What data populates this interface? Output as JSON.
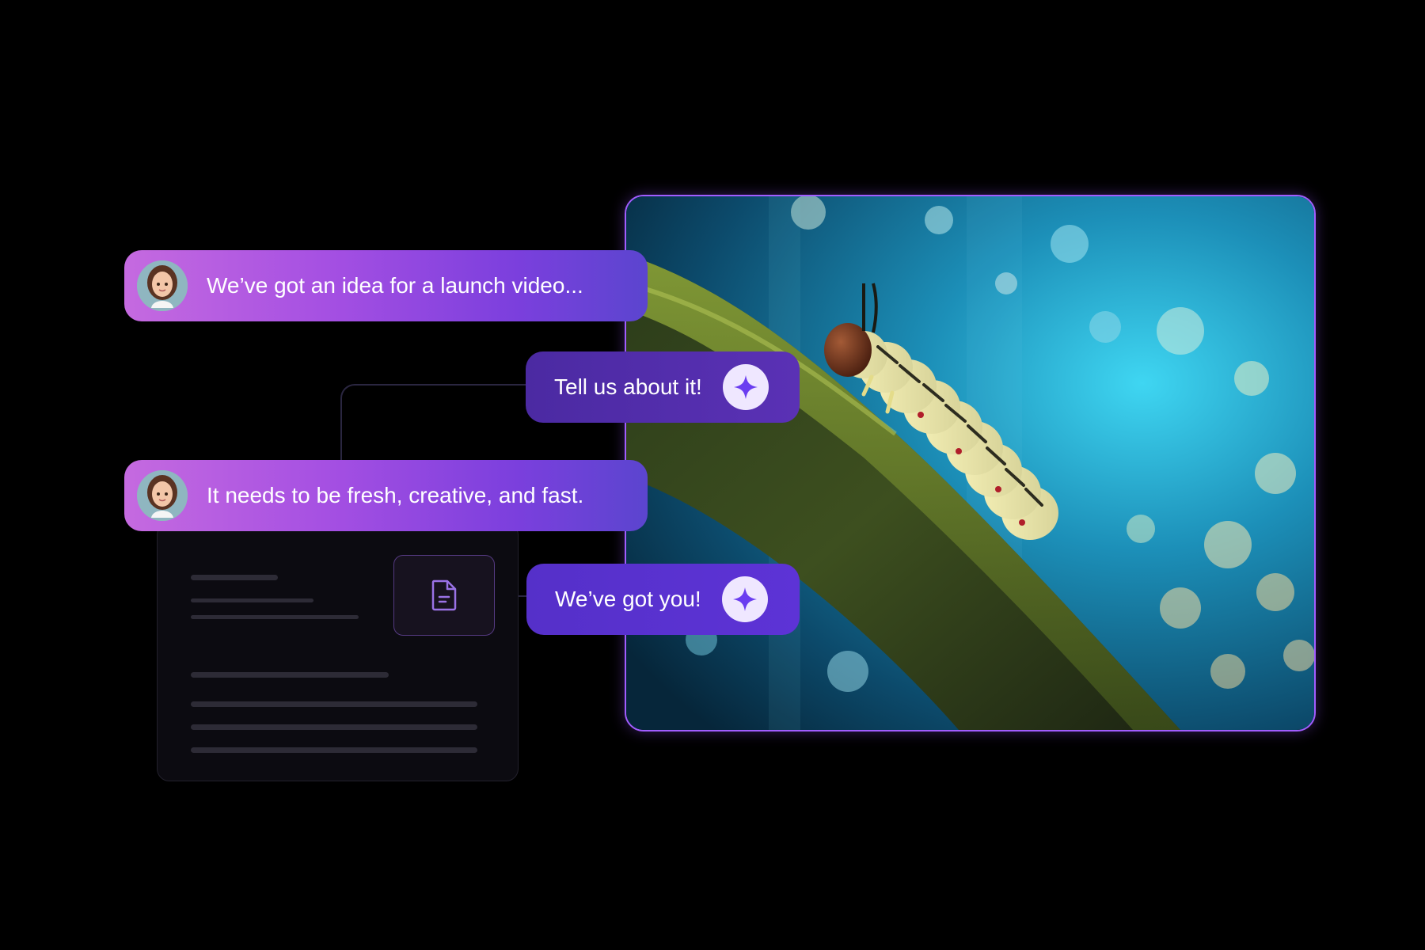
{
  "chat": {
    "messages": [
      {
        "role": "user",
        "text": "We’ve got an idea for a launch video..."
      },
      {
        "role": "assistant",
        "text": "Tell us about it!"
      },
      {
        "role": "user",
        "text": "It needs to be fresh, creative, and fast."
      },
      {
        "role": "assistant",
        "text": "We’ve got you!"
      }
    ]
  },
  "icons": {
    "user_avatar": "woman-avatar-icon",
    "assistant": "sparkle-icon",
    "document": "document-icon"
  },
  "colors": {
    "background": "#000000",
    "frame_border": "#a15dff",
    "user_bubble_start": "#c56ae0",
    "user_bubble_end": "#5b45cf",
    "assistant_bubble": "#4f2ca3",
    "accent_icon": "#6a3df0"
  },
  "media": {
    "subject": "caterpillar-on-mossy-branch"
  }
}
